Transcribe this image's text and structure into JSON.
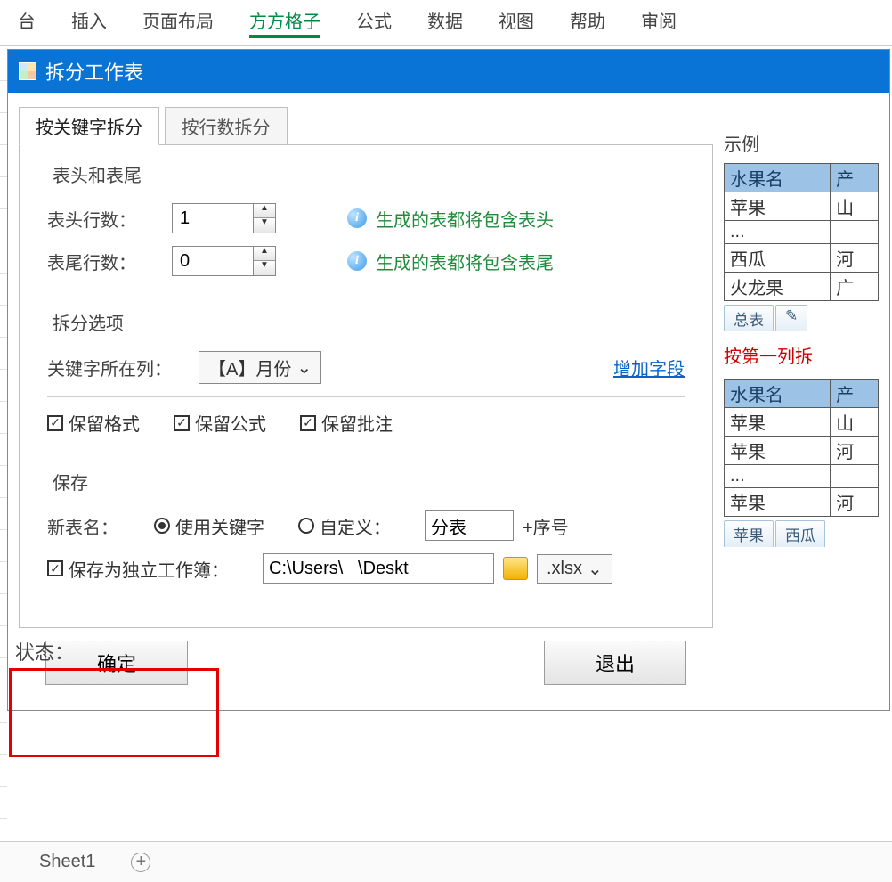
{
  "ribbon": {
    "tabs": [
      "台",
      "插入",
      "页面布局",
      "方方格子",
      "公式",
      "数据",
      "视图",
      "帮助",
      "审阅"
    ],
    "active_index": 3
  },
  "dialog": {
    "title": "拆分工作表",
    "tabs": {
      "keyword": "按关键字拆分",
      "rowcount": "按行数拆分"
    },
    "header_section": {
      "legend": "表头和表尾",
      "header_rows_label": "表头行数：",
      "header_rows_value": "1",
      "header_note": "生成的表都将包含表头",
      "footer_rows_label": "表尾行数：",
      "footer_rows_value": "0",
      "footer_note": "生成的表都将包含表尾"
    },
    "split_section": {
      "legend": "拆分选项",
      "key_col_label": "关键字所在列：",
      "key_col_value": "【A】月份",
      "add_field": "增加字段",
      "keep_format": "保留格式",
      "keep_formula": "保留公式",
      "keep_comment": "保留批注"
    },
    "save_section": {
      "legend": "保存",
      "new_name_label": "新表名：",
      "use_keyword": "使用关键字",
      "custom": "自定义：",
      "custom_value": "分表",
      "suffix_label": "+序号",
      "save_as_workbook": "保存为独立工作簿：",
      "path_value": "C:\\Users\\   \\Deskt",
      "ext_value": ".xlsx"
    },
    "buttons": {
      "ok": "确定",
      "exit": "退出"
    }
  },
  "example": {
    "title": "示例",
    "table1": {
      "headers": [
        "水果名",
        "产"
      ],
      "rows": [
        [
          "苹果",
          "山"
        ],
        [
          "...",
          ""
        ],
        [
          "西瓜",
          "河"
        ],
        [
          "火龙果",
          "广"
        ]
      ]
    },
    "master_tab": "总表",
    "red_note": "按第一列拆",
    "table2": {
      "headers": [
        "水果名",
        "产"
      ],
      "rows": [
        [
          "苹果",
          "山"
        ],
        [
          "苹果",
          "河"
        ],
        [
          "...",
          ""
        ],
        [
          "苹果",
          "河"
        ]
      ]
    },
    "tabs2": [
      "苹果",
      "西瓜"
    ]
  },
  "status": {
    "label": "状态："
  },
  "bottom": {
    "sheet": "Sheet1"
  }
}
